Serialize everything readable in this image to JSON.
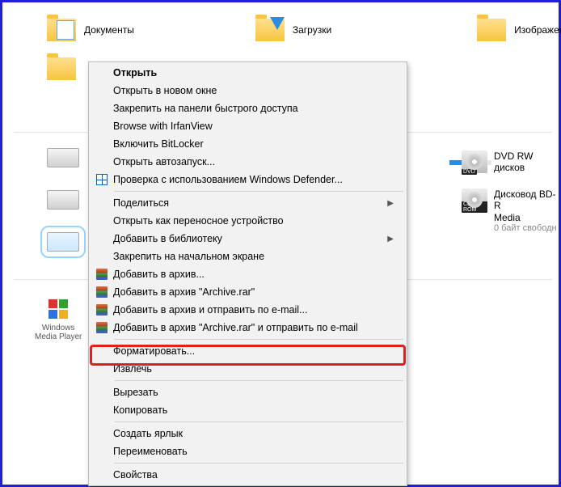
{
  "libraries": {
    "documents": "Документы",
    "downloads": "Загрузки",
    "pictures": "Изображения"
  },
  "right_drives": {
    "dvd": "DVD RW дисков",
    "bd_line1": "Дисковод BD-R",
    "bd_line2": "Media",
    "bd_badge": "CD-ROM",
    "bd_free": "0 байт свободн"
  },
  "wmp": {
    "line1": "Windows",
    "line2": "Media Player"
  },
  "context_menu": {
    "open": "Открыть",
    "open_new_window": "Открыть в новом окне",
    "pin_quick_access": "Закрепить на панели быстрого доступа",
    "browse_irfan": "Browse with IrfanView",
    "bitlocker": "Включить BitLocker",
    "autoplay": "Открыть автозапуск...",
    "defender": "Проверка с использованием Windows Defender...",
    "share": "Поделиться",
    "portable_device": "Открыть как переносное устройство",
    "add_library": "Добавить в библиотеку",
    "pin_start": "Закрепить на начальном экране",
    "add_archive": "Добавить в архив...",
    "add_archive_rar": "Добавить в архив \"Archive.rar\"",
    "add_email": "Добавить в архив и отправить по e-mail...",
    "add_rar_email": "Добавить в архив \"Archive.rar\" и отправить по e-mail",
    "format": "Форматировать...",
    "eject": "Извлечь",
    "cut": "Вырезать",
    "copy": "Копировать",
    "create_shortcut": "Создать ярлык",
    "rename": "Переименовать",
    "properties": "Свойства"
  }
}
